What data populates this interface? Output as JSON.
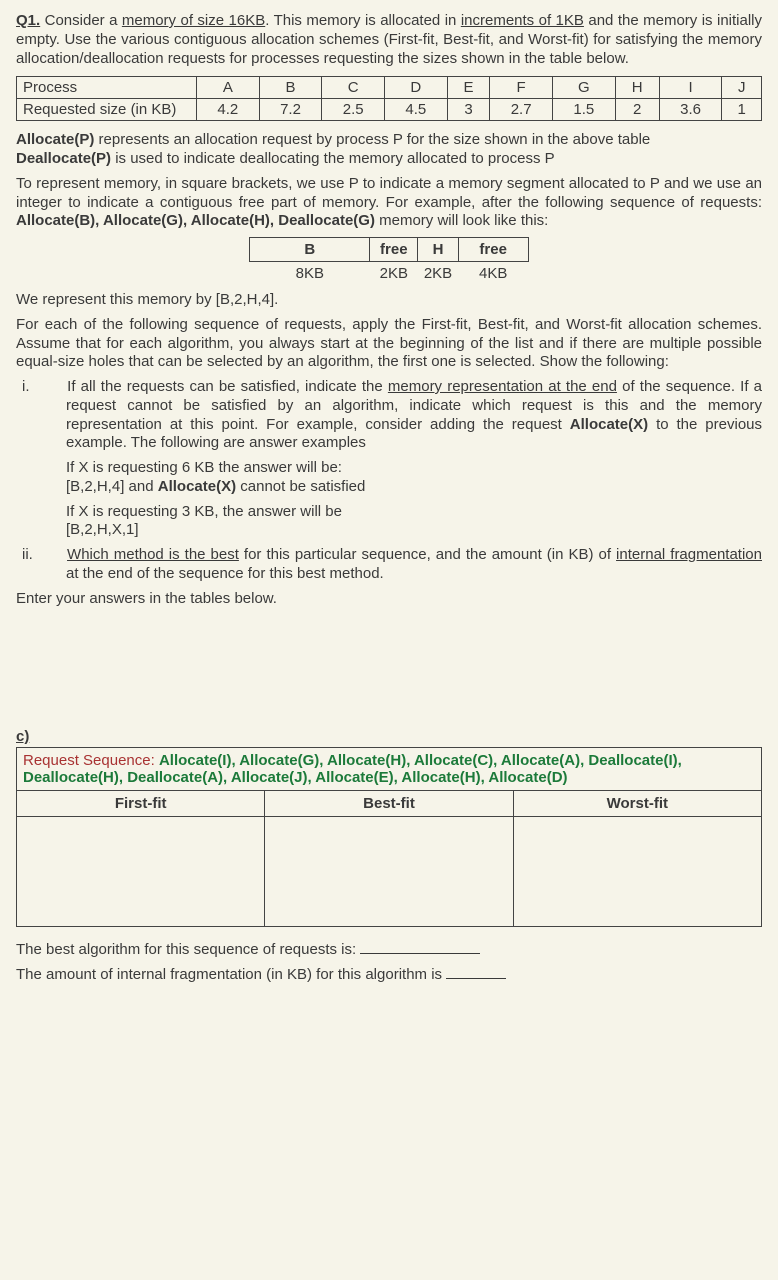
{
  "q1": {
    "title_prefix": "Q1.",
    "intro_1a": " Consider a ",
    "intro_mem": "memory of size 16KB",
    "intro_1b": ". This memory is allocated in ",
    "intro_incr": "increments of 1KB",
    "intro_1c": " and the memory is initially empty. Use the various contiguous allocation schemes (First-fit, Best-fit, and Worst-fit) for satisfying the memory allocation/deallocation requests for processes requesting the sizes shown in the table below."
  },
  "proc_table": {
    "row1_label": "Process",
    "row2_label": "Requested size (in KB)",
    "headers": [
      "A",
      "B",
      "C",
      "D",
      "E",
      "F",
      "G",
      "H",
      "I",
      "J"
    ],
    "values": [
      "4.2",
      "7.2",
      "2.5",
      "4.5",
      "3",
      "2.7",
      "1.5",
      "2",
      "3.6",
      "1"
    ]
  },
  "alloc_dealloc": {
    "line1a": "Allocate(P)",
    "line1b": " represents an allocation request by process P for the size shown in the above table",
    "line2a": "Deallocate(P)",
    "line2b": " is used to indicate deallocating the memory allocated to process P"
  },
  "mem_intro": {
    "text1": "To represent memory, in square brackets, we use P to indicate a memory segment allocated to P and we use an integer to indicate a contiguous free part of memory. For example, after the following sequence of requests: ",
    "seq": "Allocate(B), Allocate(G), Allocate(H), Deallocate(G)",
    "text2": " memory will look like this:"
  },
  "mem_example": {
    "cells": [
      "B",
      "free",
      "H",
      "free"
    ],
    "sizes": [
      "8KB",
      "2KB",
      "2KB",
      "4KB"
    ],
    "repr": "We represent this memory by [B,2,H,4]."
  },
  "main_para": {
    "text": "For each of the following sequence of requests, apply the First-fit, Best-fit, and Worst-fit allocation schemes. Assume that for each algorithm, you always start at the beginning of the list and if there are multiple possible equal-size holes that can be selected by an algorithm, the first one is selected. Show the following:"
  },
  "item_i": {
    "label": "i.",
    "text1": "If all the requests can be satisfied, indicate the ",
    "underline": "memory representation at the end",
    "text2": " of the sequence. If a request cannot be satisfied by an algorithm, indicate which request is this and the memory representation at this point. For example, consider adding the request ",
    "bold": "Allocate(X)",
    "text3": " to the previous example. The following are answer examples"
  },
  "ex1": {
    "line1": "If X is requesting 6 KB the answer will be:",
    "line2a": "[B,2,H,4] and ",
    "line2b": "Allocate(X)",
    "line2c": " cannot be satisfied"
  },
  "ex2": {
    "line1": "If X is requesting 3 KB, the answer will be",
    "line2": "[B,2,H,X,1]"
  },
  "item_ii": {
    "label": "ii.",
    "underline": "Which method is the best",
    "text1": " for this particular sequence, and the amount (in KB) of ",
    "underline2": "internal fragmentation",
    "text2": " at the end of the sequence for this best method."
  },
  "enter_line": "Enter your answers in the tables below.",
  "part_c": {
    "label": "c)",
    "req_prefix": "Request Sequence: ",
    "seq_line1": "Allocate(I), Allocate(G), Allocate(H), Allocate(C), Allocate(A), Deallocate(I), Deallocate(H), Deallocate(A), Allocate(J), Allocate(E), Allocate(H), Allocate(D)"
  },
  "answer_cols": {
    "c1": "First-fit",
    "c2": "Best-fit",
    "c3": "Worst-fit"
  },
  "footer": {
    "line1": "The best algorithm for this sequence of requests is: ",
    "line2": "The amount of internal fragmentation (in KB) for this algorithm is "
  }
}
